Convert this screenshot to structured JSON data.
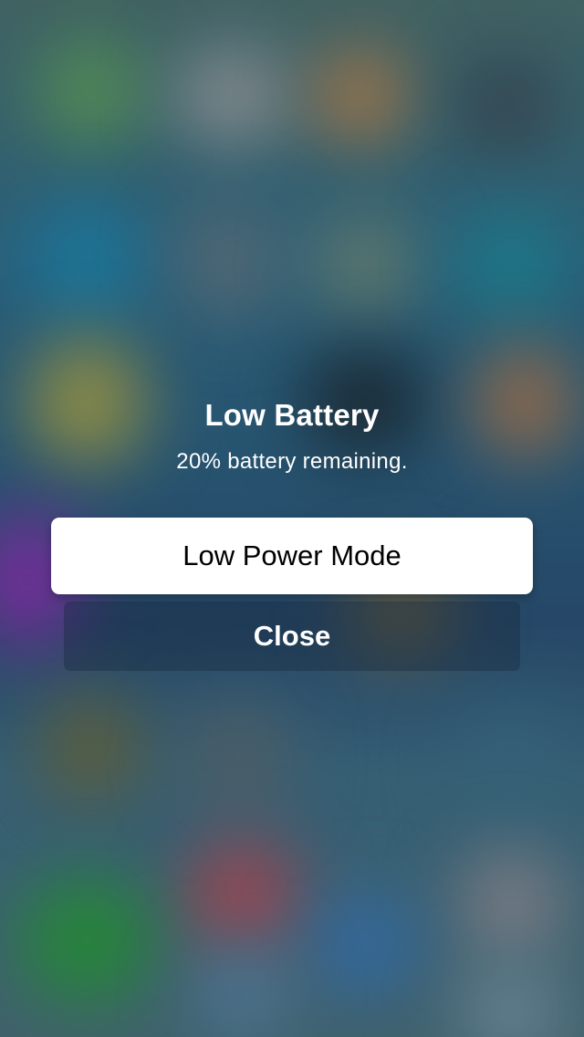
{
  "alert": {
    "title": "Low Battery",
    "message": "20% battery remaining.",
    "primary_button": "Low Power Mode",
    "secondary_button": "Close"
  },
  "colors": {
    "primary_button_bg": "#ffffff",
    "text_on_blur": "#ffffff"
  }
}
